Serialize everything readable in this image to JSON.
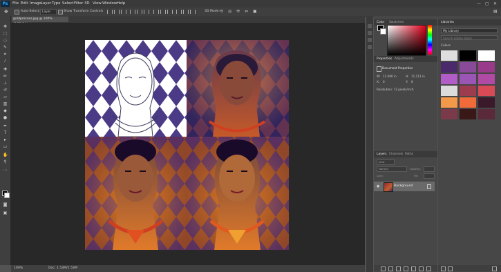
{
  "app": {
    "logo": "Ps"
  },
  "menu": [
    "File",
    "Edit",
    "Image",
    "Layer",
    "Type",
    "Select",
    "Filter",
    "3D",
    "View",
    "Window",
    "Help"
  ],
  "window_controls": [
    "—",
    "▢",
    "✕"
  ],
  "options": {
    "auto_select_label": "Auto-Select:",
    "auto_select_value": "Layer",
    "transform_label": "Show Transform Controls",
    "mode_3d": "3D Mode:"
  },
  "document": {
    "tab_title": "goldprocess.jpg @ 100% (RGB/8#) *",
    "zoom": "100%",
    "doc_info": "Doc: 1.53M/1.53M"
  },
  "color_panel": {
    "tabs": [
      "Color",
      "Swatches"
    ]
  },
  "properties_panel": {
    "tabs": [
      "Properties",
      "Adjustments"
    ],
    "title": "Document Properties",
    "w_label": "W:",
    "w_value": "11.000 in",
    "h_label": "H:",
    "h_value": "11.111 in",
    "x_label": "X:",
    "x_value": "0",
    "y_label": "Y:",
    "y_value": "0",
    "resolution": "Resolution: 72 pixels/inch"
  },
  "layers_panel": {
    "tabs": [
      "Layers",
      "Channels",
      "Paths"
    ],
    "kind_placeholder": "Kind",
    "blend_mode": "Normal",
    "opacity_label": "Opacity:",
    "lock_label": "Lock:",
    "fill_label": "Fill:",
    "layer_name": "Background"
  },
  "libraries_panel": {
    "title": "Libraries",
    "library_name": "My Library",
    "search_placeholder": "Search Adobe Stock",
    "colors_label": "Colors",
    "swatches": [
      "#dedede",
      "#000000",
      "#ffffff",
      "#4a2a6a",
      "#8a4a9a",
      "#9a3a8a",
      "#b25cc8",
      "#9a55b5",
      "#b04aa4",
      "#dcdcdc",
      "#9c3c4e",
      "#d84a56",
      "#f39a4a",
      "#f06a3a",
      "#3a1a2a",
      "#7a3a4a",
      "#3a1818",
      "#5a2a3a"
    ]
  },
  "colors": {
    "accent": "#31a8ff",
    "chrome": "#535353"
  }
}
